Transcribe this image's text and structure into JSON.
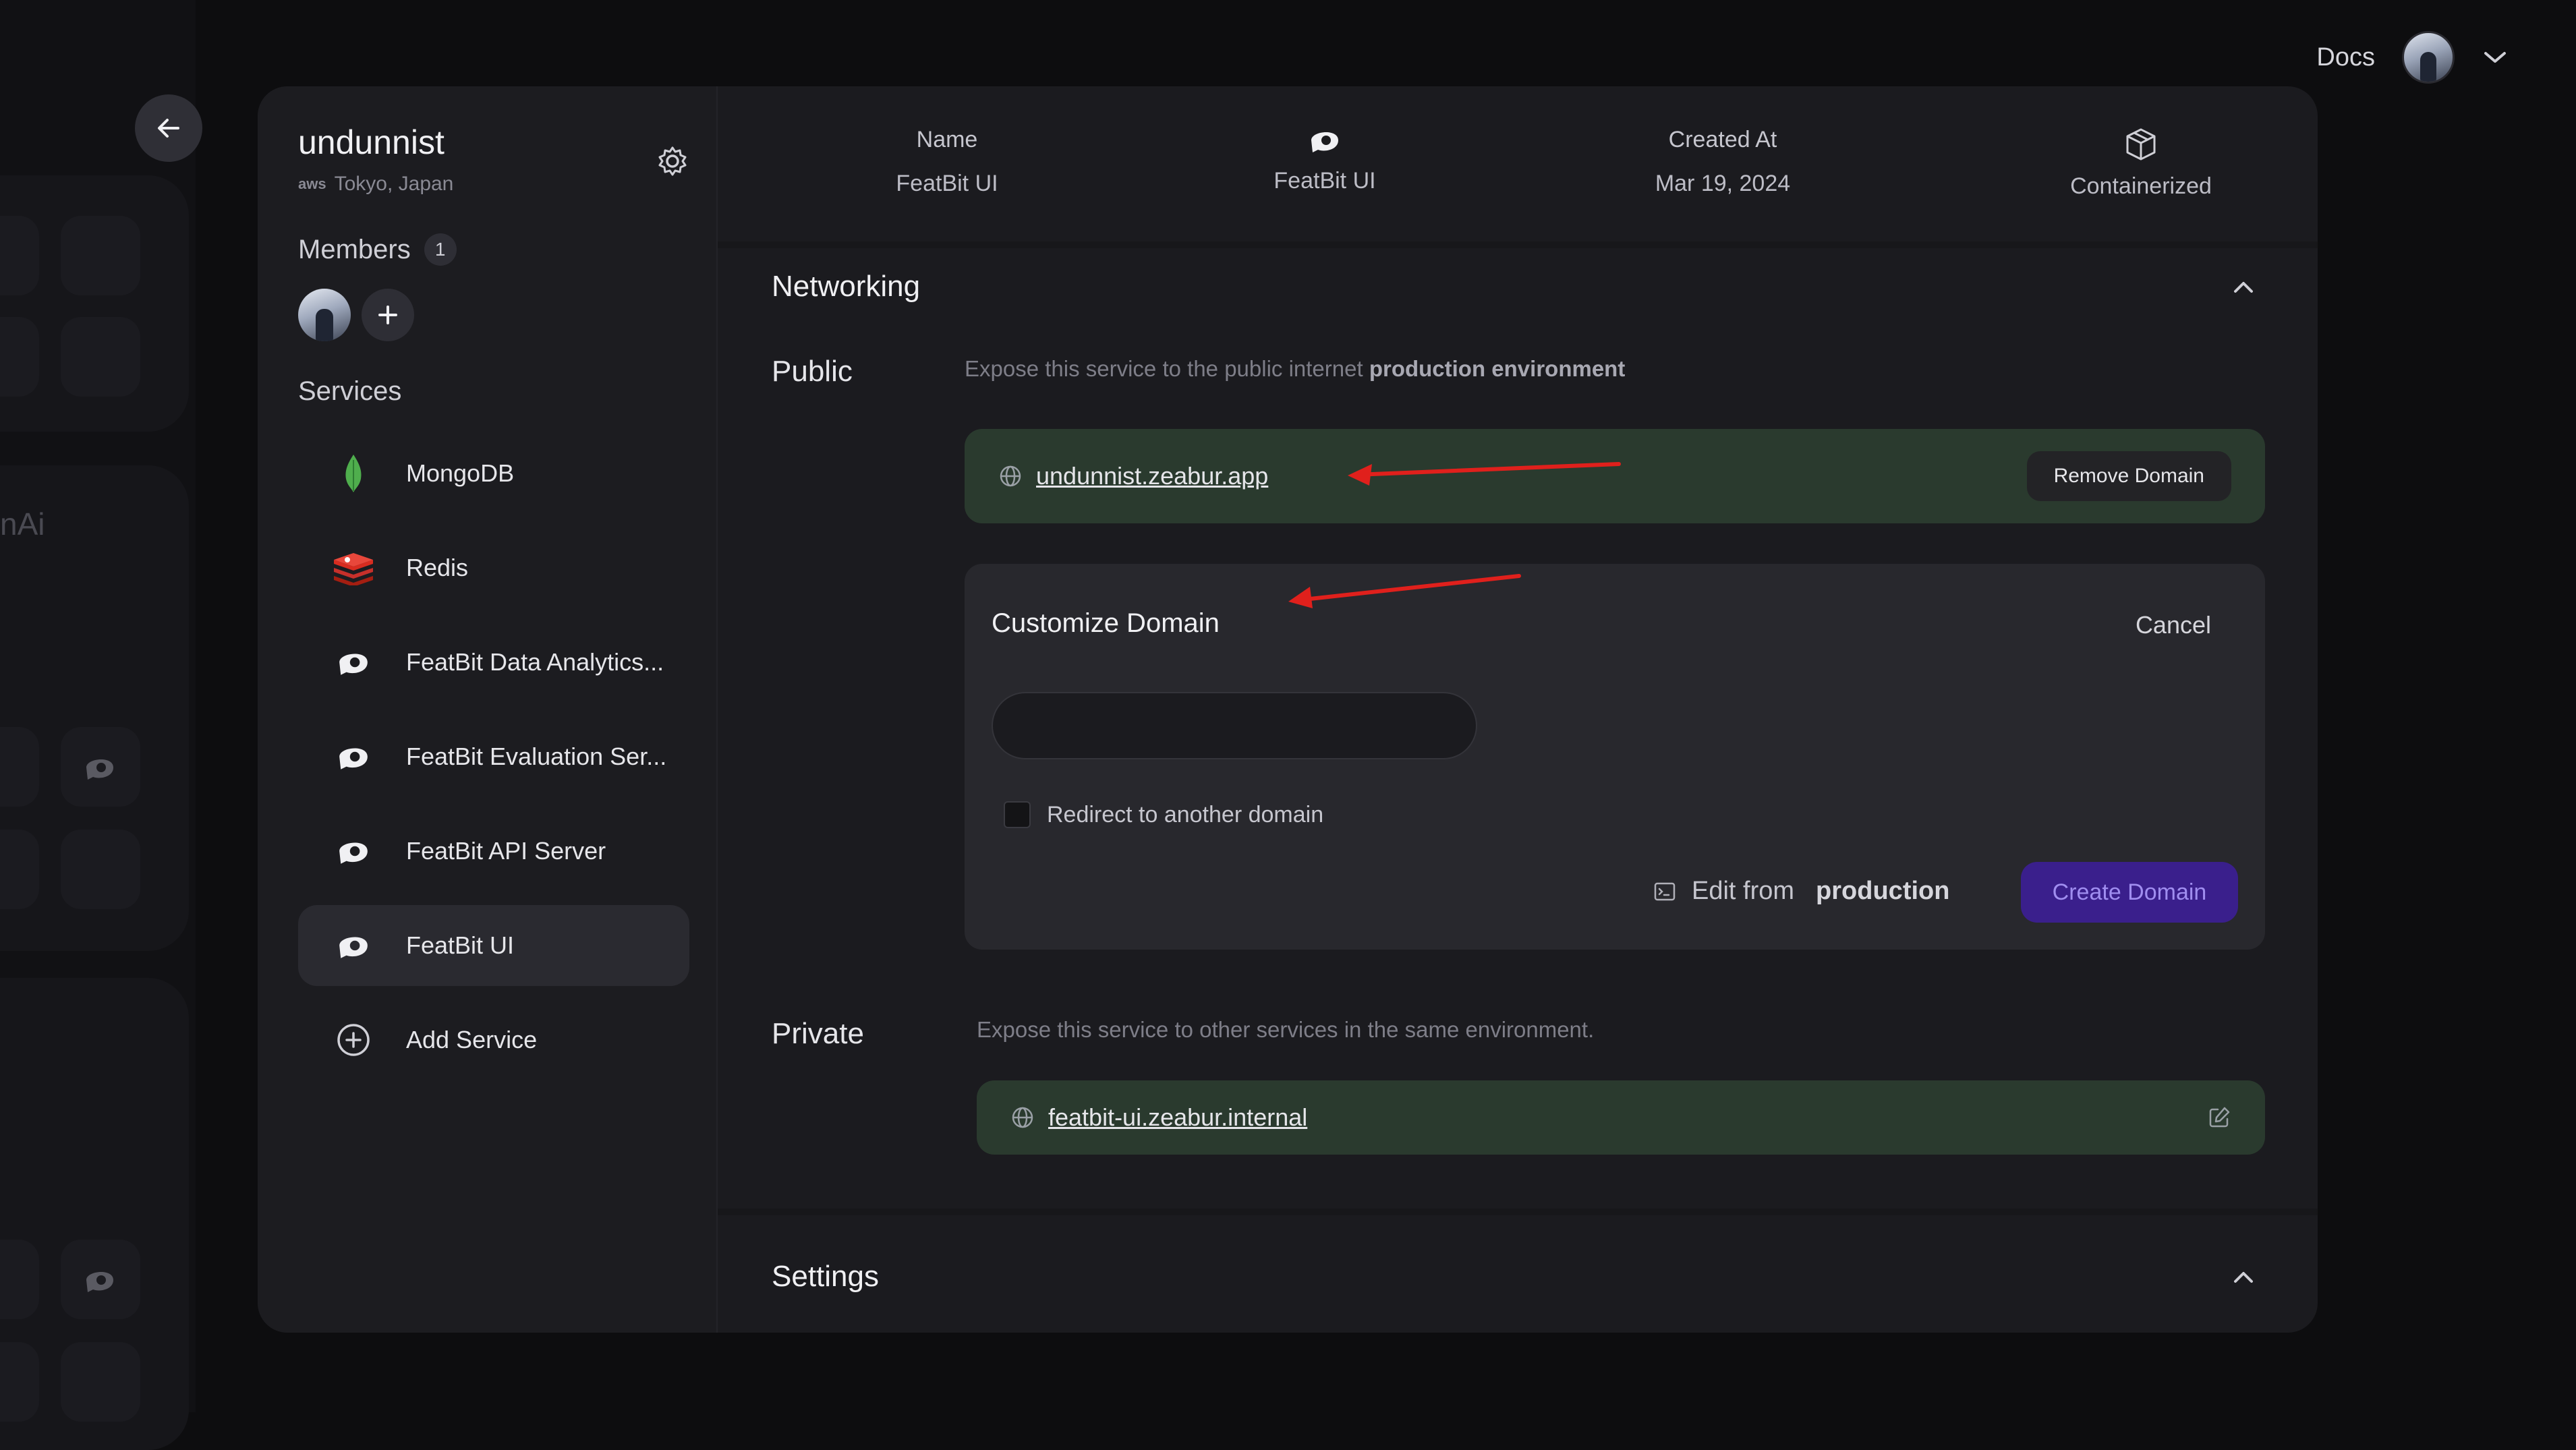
{
  "topbar": {
    "docs_label": "Docs"
  },
  "background": {
    "partial_text": "nAi"
  },
  "project": {
    "name": "undunnist",
    "provider": "aws",
    "location": "Tokyo, Japan"
  },
  "members": {
    "title": "Members",
    "count": "1"
  },
  "services": {
    "title": "Services",
    "items": [
      {
        "label": "MongoDB",
        "icon": "mongodb-icon"
      },
      {
        "label": "Redis",
        "icon": "redis-icon"
      },
      {
        "label": "FeatBit Data Analytics...",
        "icon": "featbit-icon"
      },
      {
        "label": "FeatBit Evaluation Ser...",
        "icon": "featbit-icon"
      },
      {
        "label": "FeatBit API Server",
        "icon": "featbit-icon"
      },
      {
        "label": "FeatBit UI",
        "icon": "featbit-icon",
        "active": true
      },
      {
        "label": "Add Service",
        "icon": "plus-circle-icon"
      }
    ]
  },
  "info": {
    "name_label": "Name",
    "name_value": "FeatBit UI",
    "template_value": "FeatBit UI",
    "created_label": "Created At",
    "created_value": "Mar 19, 2024",
    "type_value": "Containerized"
  },
  "networking": {
    "title": "Networking",
    "public": {
      "title": "Public",
      "desc_prefix": "Expose this service to the public internet",
      "desc_bold": "production environment",
      "domain": "undunnist.zeabur.app",
      "remove_label": "Remove Domain"
    },
    "customize": {
      "title": "Customize Domain",
      "cancel_label": "Cancel",
      "input_value": "",
      "redirect_label": "Redirect to another domain",
      "edit_from_label": "Edit from",
      "edit_from_env": "production",
      "create_label": "Create Domain"
    },
    "private": {
      "title": "Private",
      "desc": "Expose this service to other services in the same environment.",
      "domain": "featbit-ui.zeabur.internal"
    }
  },
  "settings": {
    "title": "Settings"
  },
  "colors": {
    "accent_button": "#3a1f8c",
    "domain_bar": "#2a3a2e",
    "annotation_arrow": "#e0201c"
  }
}
